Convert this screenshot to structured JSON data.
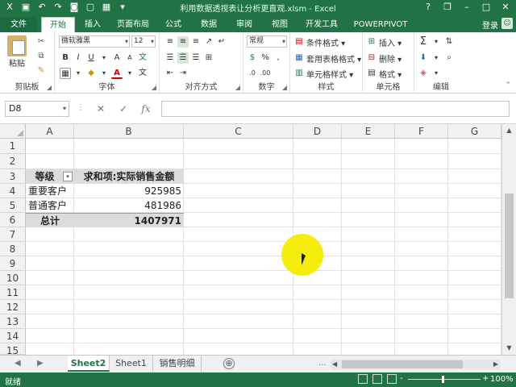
{
  "window": {
    "title": "利用数据透视表让分析更直观.xlsm - Excel",
    "qat_icons": [
      "excel-logo-icon",
      "save-icon",
      "undo-icon",
      "redo-icon",
      "camera-icon",
      "new-file-icon",
      "table-icon",
      "customize-icon"
    ],
    "controls": {
      "help": "?",
      "restore": "❐",
      "minimize": "–",
      "maximize": "□",
      "close": "✕"
    }
  },
  "ribbon_tabs": {
    "file": "文件",
    "items": [
      "开始",
      "插入",
      "页面布局",
      "公式",
      "数据",
      "审阅",
      "视图",
      "开发工具",
      "POWERPIVOT"
    ],
    "active": "开始",
    "login": "登录"
  },
  "ribbon": {
    "clipboard": {
      "paste": "粘贴",
      "label": "剪贴板"
    },
    "font": {
      "name": "微软雅黑",
      "size": "12",
      "bold": "B",
      "italic": "I",
      "underline": "U",
      "grow": "A",
      "shrink": "A",
      "font_color": "A",
      "label": "字体"
    },
    "alignment": {
      "label": "对齐方式"
    },
    "number": {
      "format": "常规",
      "percent": "%",
      "comma": ",",
      "label": "数字"
    },
    "styles": {
      "conditional": "条件格式 ▾",
      "table": "套用表格格式 ▾",
      "cell": "单元格样式 ▾",
      "label": "样式"
    },
    "cells": {
      "insert": "插入 ▾",
      "delete": "删除 ▾",
      "format": "格式 ▾",
      "label": "单元格"
    },
    "editing": {
      "label": "编辑"
    }
  },
  "formula_bar": {
    "name_box": "D8",
    "cancel": "✕",
    "enter": "✓",
    "function": "fx",
    "content": ""
  },
  "columns": [
    "A",
    "B",
    "C",
    "D",
    "E",
    "F",
    "G"
  ],
  "rows": [
    "1",
    "2",
    "3",
    "4",
    "5",
    "6",
    "7",
    "8",
    "9",
    "10",
    "11",
    "12",
    "13",
    "14",
    "15"
  ],
  "pivot": {
    "header": {
      "row_label": "等级",
      "value_label": "求和项:实际销售金额"
    },
    "rows": [
      {
        "label": "重要客户",
        "value": "925985"
      },
      {
        "label": "普通客户",
        "value": "481986"
      }
    ],
    "total": {
      "label": "总计",
      "value": "1407971"
    }
  },
  "sheets": {
    "tabs": [
      "Sheet2",
      "Sheet1",
      "销售明细"
    ],
    "active": "Sheet2",
    "add": "⊕",
    "nav_prev": "◀",
    "nav_next": "▶",
    "more": "..."
  },
  "status": {
    "ready": "就绪",
    "zoom": "100%",
    "zoom_minus": "-",
    "zoom_plus": "+"
  }
}
